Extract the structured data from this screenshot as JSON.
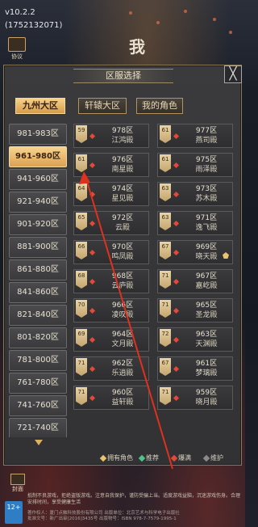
{
  "app": {
    "version": "v10.2.2",
    "build": "(1752132071)",
    "logo_text": "我"
  },
  "top_buttons": {
    "notice_label": "协议",
    "cover_label": "封面"
  },
  "dialog": {
    "title": "区服选择",
    "close_glyph": "╳",
    "tabs": [
      {
        "label": "九州大区",
        "active": true
      },
      {
        "label": "轩辕大区",
        "active": false
      },
      {
        "label": "我的角色",
        "active": false
      }
    ],
    "ranges": [
      {
        "label": "981-983区",
        "active": false
      },
      {
        "label": "961-980区",
        "active": true
      },
      {
        "label": "941-960区",
        "active": false
      },
      {
        "label": "921-940区",
        "active": false
      },
      {
        "label": "901-920区",
        "active": false
      },
      {
        "label": "881-900区",
        "active": false
      },
      {
        "label": "861-880区",
        "active": false
      },
      {
        "label": "841-860区",
        "active": false
      },
      {
        "label": "821-840区",
        "active": false
      },
      {
        "label": "801-820区",
        "active": false
      },
      {
        "label": "781-800区",
        "active": false
      },
      {
        "label": "761-780区",
        "active": false
      },
      {
        "label": "741-760区",
        "active": false
      },
      {
        "label": "721-740区",
        "active": false
      }
    ],
    "servers": [
      {
        "level": "59",
        "zone": "978区",
        "name": "江鸿殿",
        "owned": false
      },
      {
        "level": "61",
        "zone": "977区",
        "name": "燕司殿",
        "owned": false
      },
      {
        "level": "61",
        "zone": "976区",
        "name": "南星殿",
        "owned": false
      },
      {
        "level": "61",
        "zone": "975区",
        "name": "雨泽殿",
        "owned": false
      },
      {
        "level": "64",
        "zone": "974区",
        "name": "星见殿",
        "owned": false
      },
      {
        "level": "63",
        "zone": "973区",
        "name": "苏木殿",
        "owned": false
      },
      {
        "level": "65",
        "zone": "972区",
        "name": "云殿",
        "owned": false
      },
      {
        "level": "63",
        "zone": "971区",
        "name": "逸飞殿",
        "owned": false
      },
      {
        "level": "66",
        "zone": "970区",
        "name": "鸣凤殿",
        "owned": false
      },
      {
        "level": "67",
        "zone": "969区",
        "name": "晓天殿",
        "owned": true
      },
      {
        "level": "68",
        "zone": "968区",
        "name": "云庐殿",
        "owned": false
      },
      {
        "level": "71",
        "zone": "967区",
        "name": "嘉屹殿",
        "owned": false
      },
      {
        "level": "70",
        "zone": "966区",
        "name": "凌叹殿",
        "owned": false
      },
      {
        "level": "71",
        "zone": "965区",
        "name": "圣龙殿",
        "owned": false
      },
      {
        "level": "69",
        "zone": "964区",
        "name": "文月殿",
        "owned": false
      },
      {
        "level": "72",
        "zone": "963区",
        "name": "天渊殿",
        "owned": false
      },
      {
        "level": "71",
        "zone": "962区",
        "name": "乐逍殿",
        "owned": false
      },
      {
        "level": "67",
        "zone": "961区",
        "name": "梦璃殿",
        "owned": false
      },
      {
        "level": "71",
        "zone": "960区",
        "name": "益轩殿",
        "owned": false
      },
      {
        "level": "71",
        "zone": "959区",
        "name": "晓月殿",
        "owned": false
      }
    ],
    "legend": {
      "owned": "拥有角色",
      "recommended": "推荐",
      "full": "爆满",
      "maintenance": "维护"
    }
  },
  "footer": {
    "age_rating": "12+",
    "warning": "抵制不良游戏，拒绝盗版游戏。注意自我保护，谨防受骗上当。适度游戏益脑，沉迷游戏伤身。合理安排时间，享受健康生活",
    "publisher": "著作权人：厦门点触科技股份有限公司    出版单位：北京艺术与科学电子出版社",
    "approval": "批准文号：新广出审[2016]3435号    出版物号：ISBN 978-7-7579-1995-1"
  },
  "colors": {
    "accent_gold": "#dca152",
    "status_red": "#e04a3a",
    "panel_bg": "#3b3b3d"
  }
}
